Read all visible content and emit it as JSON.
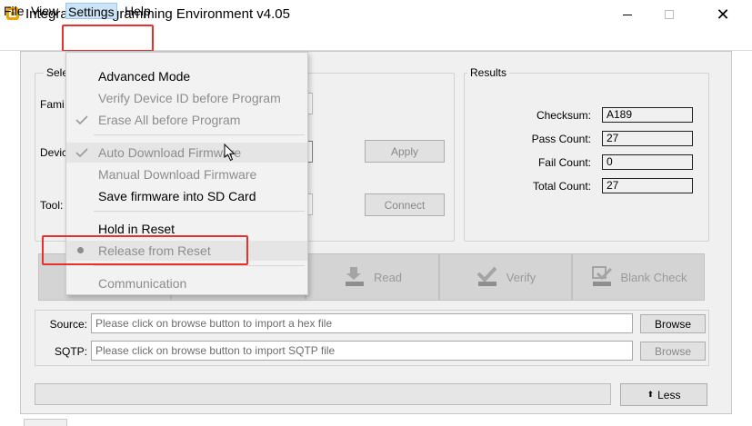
{
  "window": {
    "title": "Integrated Programming Environment v4.05",
    "close_glyph": "✕"
  },
  "menubar": {
    "items": [
      {
        "label": "File"
      },
      {
        "label": "View"
      },
      {
        "label": "Settings"
      },
      {
        "label": "Help"
      }
    ]
  },
  "select_group": {
    "title": "Sele",
    "family_label": "Fami",
    "device_label": "Devic",
    "tool_label": "Tool:",
    "apply_label": "Apply",
    "connect_label": "Connect"
  },
  "results": {
    "title": "Results",
    "rows": [
      {
        "label": "Checksum:",
        "value": "A189"
      },
      {
        "label": "Pass Count:",
        "value": "27"
      },
      {
        "label": "Fail Count:",
        "value": "0"
      },
      {
        "label": "Total Count:",
        "value": "27"
      }
    ]
  },
  "toolbar": {
    "read_label": "Read",
    "verify_label": "Verify",
    "blank_check_label": "Blank Check"
  },
  "source": {
    "label": "Source:",
    "placeholder": "Please click on browse button to import a hex file",
    "browse_label": "Browse"
  },
  "sqtp": {
    "label": "SQTP:",
    "placeholder": "Please click on browse button to import SQTP file",
    "browse_label": "Browse"
  },
  "less_button": {
    "glyph": "⬆",
    "label": "Less"
  },
  "settings_menu": {
    "items": [
      {
        "label": "Advanced Mode"
      },
      {
        "label": "Verify Device ID before Program"
      },
      {
        "label": "Erase All before Program"
      },
      {
        "label": "Auto Download Firmware"
      },
      {
        "label": "Manual Download Firmware"
      },
      {
        "label": "Save firmware into SD Card"
      },
      {
        "label": "Hold in Reset"
      },
      {
        "label": "Release from Reset"
      },
      {
        "label": "Communication"
      }
    ]
  },
  "colors": {
    "highlight_red": "#e8312f",
    "menu_selected_bg": "#cce4f7",
    "app_icon": "#f4a100"
  },
  "icons": {
    "app": "ipe-app-icon",
    "read": "read-chip-icon",
    "verify": "verify-check-icon",
    "blank_check": "blank-check-icon",
    "check": "checkmark-icon",
    "bullet": "radio-bullet-icon",
    "cursor": "mouse-pointer-icon"
  }
}
